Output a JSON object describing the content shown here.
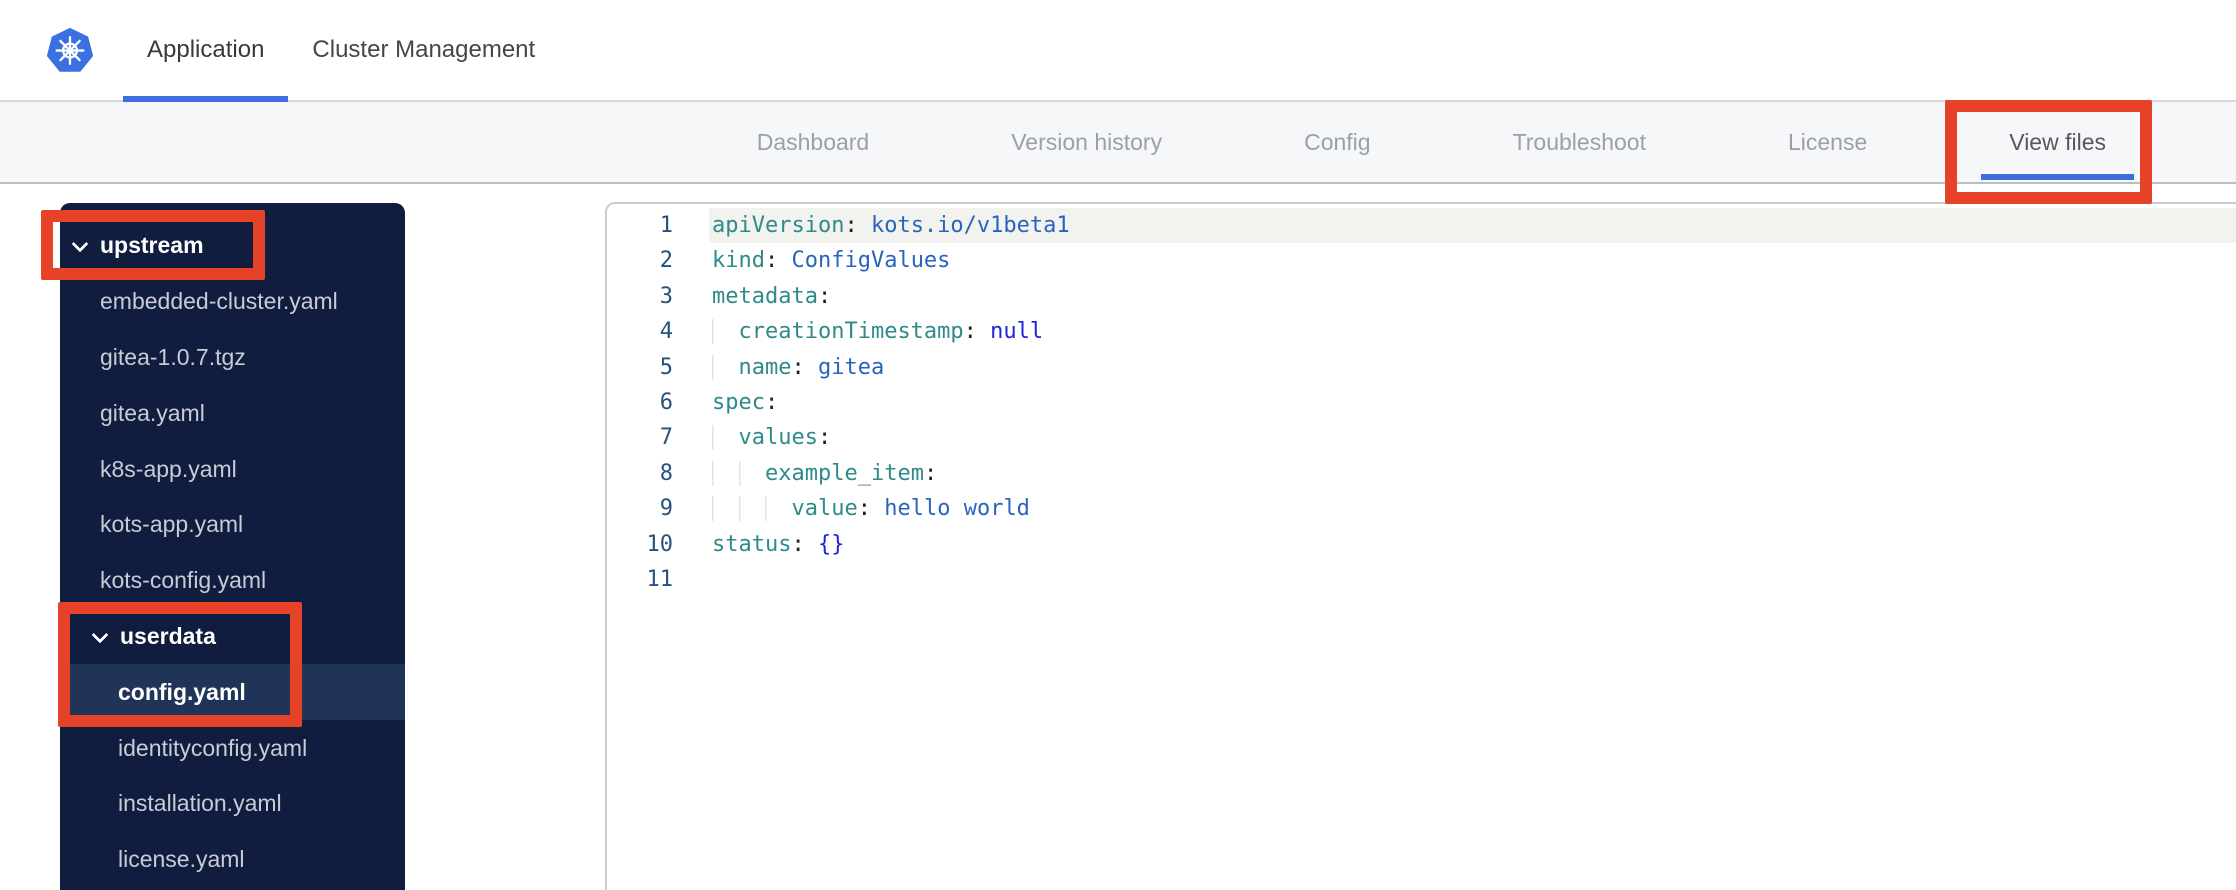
{
  "header": {
    "logo": "kubernetes-logo",
    "tabs": [
      {
        "label": "Application",
        "active": true
      },
      {
        "label": "Cluster Management",
        "active": false
      }
    ]
  },
  "subnav": {
    "items": [
      {
        "label": "Dashboard",
        "active": false
      },
      {
        "label": "Version history",
        "active": false
      },
      {
        "label": "Config",
        "active": false
      },
      {
        "label": "Troubleshoot",
        "active": false
      },
      {
        "label": "License",
        "active": false
      },
      {
        "label": "View files",
        "active": true,
        "annotated": true
      }
    ]
  },
  "file_tree": {
    "items": [
      {
        "label": "upstream",
        "type": "folder",
        "level": 0,
        "expanded": true,
        "selected": false,
        "annotated": true
      },
      {
        "label": "embedded-cluster.yaml",
        "type": "file",
        "level": 1,
        "selected": false
      },
      {
        "label": "gitea-1.0.7.tgz",
        "type": "file",
        "level": 1,
        "selected": false
      },
      {
        "label": "gitea.yaml",
        "type": "file",
        "level": 1,
        "selected": false
      },
      {
        "label": "k8s-app.yaml",
        "type": "file",
        "level": 1,
        "selected": false
      },
      {
        "label": "kots-app.yaml",
        "type": "file",
        "level": 1,
        "selected": false
      },
      {
        "label": "kots-config.yaml",
        "type": "file",
        "level": 1,
        "selected": false
      },
      {
        "label": "userdata",
        "type": "folder",
        "level": 1,
        "expanded": true,
        "selected": false,
        "annotated": true
      },
      {
        "label": "config.yaml",
        "type": "file",
        "level": 2,
        "selected": true,
        "annotated": true
      },
      {
        "label": "identityconfig.yaml",
        "type": "file",
        "level": 2,
        "selected": false
      },
      {
        "label": "installation.yaml",
        "type": "file",
        "level": 2,
        "selected": false
      },
      {
        "label": "license.yaml",
        "type": "file",
        "level": 2,
        "selected": false
      }
    ]
  },
  "editor": {
    "language": "yaml",
    "lines": [
      {
        "number": 1,
        "highlighted": true,
        "tokens": [
          {
            "c": "key",
            "t": "apiVersion"
          },
          {
            "c": "pn",
            "t": ": "
          },
          {
            "c": "val",
            "t": "kots.io/v1beta1"
          }
        ]
      },
      {
        "number": 2,
        "tokens": [
          {
            "c": "key",
            "t": "kind"
          },
          {
            "c": "pn",
            "t": ": "
          },
          {
            "c": "val",
            "t": "ConfigValues"
          }
        ]
      },
      {
        "number": 3,
        "tokens": [
          {
            "c": "key",
            "t": "metadata"
          },
          {
            "c": "pn",
            "t": ":"
          }
        ]
      },
      {
        "number": 4,
        "tokens": [
          {
            "c": "ig",
            "t": "  "
          },
          {
            "c": "key",
            "t": "creationTimestamp"
          },
          {
            "c": "pn",
            "t": ": "
          },
          {
            "c": "kw",
            "t": "null"
          }
        ]
      },
      {
        "number": 5,
        "tokens": [
          {
            "c": "ig",
            "t": "  "
          },
          {
            "c": "key",
            "t": "name"
          },
          {
            "c": "pn",
            "t": ": "
          },
          {
            "c": "val",
            "t": "gitea"
          }
        ]
      },
      {
        "number": 6,
        "tokens": [
          {
            "c": "key",
            "t": "spec"
          },
          {
            "c": "pn",
            "t": ":"
          }
        ]
      },
      {
        "number": 7,
        "tokens": [
          {
            "c": "ig",
            "t": "  "
          },
          {
            "c": "key",
            "t": "values"
          },
          {
            "c": "pn",
            "t": ":"
          }
        ]
      },
      {
        "number": 8,
        "tokens": [
          {
            "c": "ig",
            "t": "  "
          },
          {
            "c": "ig",
            "t": "  "
          },
          {
            "c": "key",
            "t": "example_item"
          },
          {
            "c": "pn",
            "t": ":"
          }
        ]
      },
      {
        "number": 9,
        "tokens": [
          {
            "c": "ig",
            "t": "  "
          },
          {
            "c": "ig",
            "t": "  "
          },
          {
            "c": "ig",
            "t": "  "
          },
          {
            "c": "key",
            "t": "value"
          },
          {
            "c": "pn",
            "t": ": "
          },
          {
            "c": "val",
            "t": "hello world"
          }
        ]
      },
      {
        "number": 10,
        "tokens": [
          {
            "c": "key",
            "t": "status"
          },
          {
            "c": "pn",
            "t": ": "
          },
          {
            "c": "kw",
            "t": "{}"
          }
        ]
      },
      {
        "number": 11,
        "tokens": []
      }
    ]
  },
  "annotations": {
    "boxes": [
      "view-files-tab",
      "upstream-folder",
      "userdata-config-yaml"
    ]
  },
  "colors": {
    "accent_blue": "#3f6de0",
    "annotation_red": "#e64228",
    "k8s_blue": "#3a70e2",
    "sidebar_bg": "#101d3f",
    "sidebar_selected": "#203457",
    "code_key": "#2f8a8a",
    "code_value": "#2a63bd",
    "code_keyword": "#1e22d8"
  }
}
